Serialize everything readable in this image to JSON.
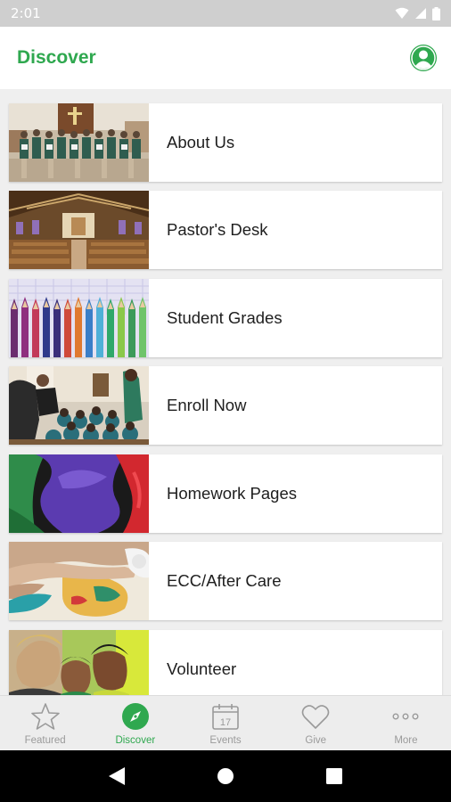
{
  "status_bar": {
    "time": "2:01"
  },
  "header": {
    "title": "Discover"
  },
  "items": [
    {
      "label": "About Us",
      "image": "choir-group-photo"
    },
    {
      "label": "Pastor's Desk",
      "image": "church-interior-photo"
    },
    {
      "label": "Student Grades",
      "image": "colored-pencils-photo"
    },
    {
      "label": "Enroll Now",
      "image": "classroom-students-photo"
    },
    {
      "label": "Homework Pages",
      "image": "colored-paper-photo"
    },
    {
      "label": "ECC/After Care",
      "image": "finger-painting-photo"
    },
    {
      "label": "Volunteer",
      "image": "volunteers-children-photo"
    }
  ],
  "tabs": [
    {
      "label": "Featured",
      "icon": "star-icon",
      "active": false
    },
    {
      "label": "Discover",
      "icon": "compass-icon",
      "active": true
    },
    {
      "label": "Events",
      "icon": "calendar-icon",
      "active": false,
      "icon_text": "17"
    },
    {
      "label": "Give",
      "icon": "heart-icon",
      "active": false
    },
    {
      "label": "More",
      "icon": "more-icon",
      "active": false
    }
  ],
  "colors": {
    "accent": "#2fa84f",
    "inactive": "#9a9a9a"
  }
}
